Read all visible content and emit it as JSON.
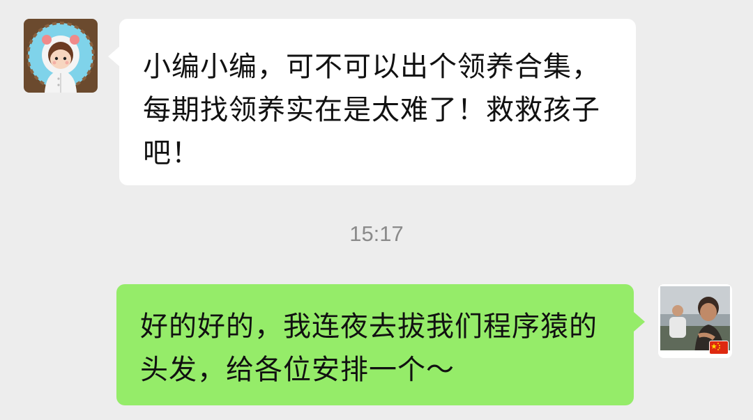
{
  "chat": {
    "messages": [
      {
        "side": "left",
        "sender_avatar": "cartoon-girl-avatar",
        "text": "小编小编，可不可以出个领养合集，每期找领养实在是太难了！救救孩子吧！"
      },
      {
        "side": "right",
        "sender_avatar": "photo-avatar-with-china-flag",
        "text": "好的好的，我连夜去拔我们程序猿的头发，给各位安排一个～"
      }
    ],
    "timestamp": "15:17"
  },
  "colors": {
    "background": "#ededed",
    "incoming_bubble": "#ffffff",
    "outgoing_bubble": "#95ec69",
    "timestamp": "#8a8a8a"
  }
}
